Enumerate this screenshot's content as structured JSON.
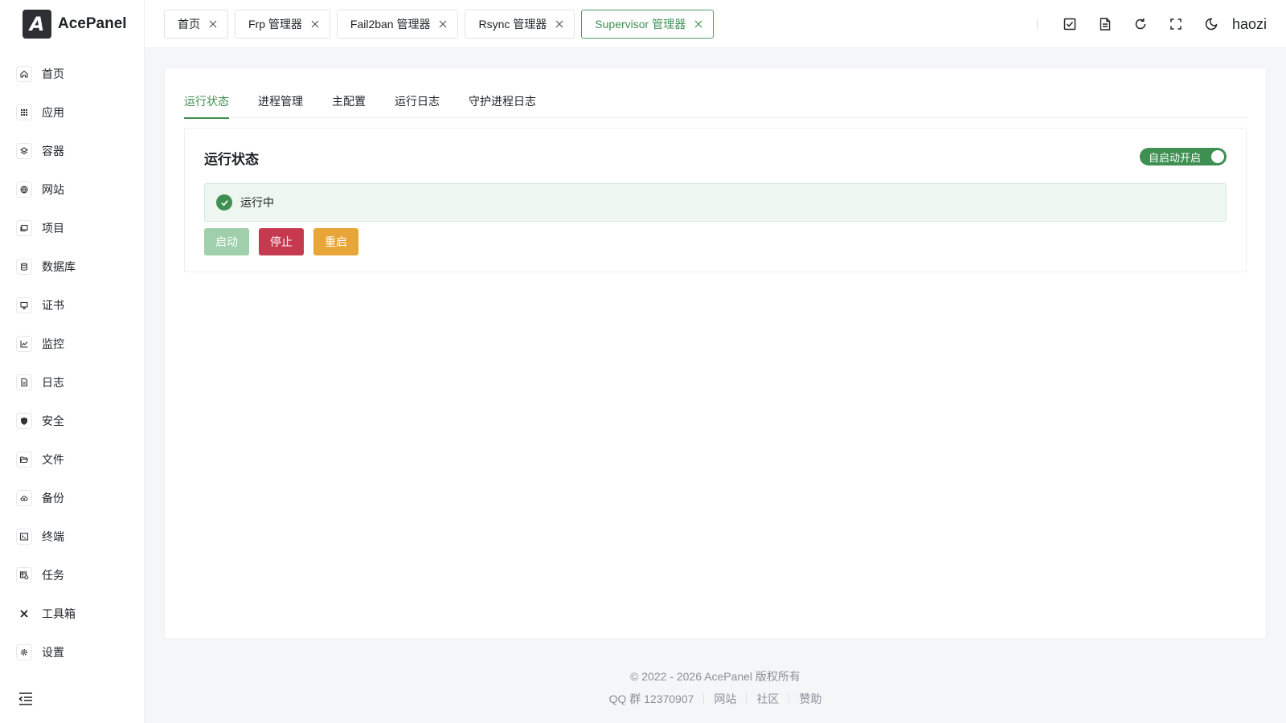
{
  "app": {
    "name": "AcePanel",
    "logo_letter": "A"
  },
  "sidebar": {
    "items": [
      {
        "label": "首页",
        "icon": "home-icon"
      },
      {
        "label": "应用",
        "icon": "apps-grid-icon"
      },
      {
        "label": "容器",
        "icon": "layers-icon"
      },
      {
        "label": "网站",
        "icon": "globe-icon"
      },
      {
        "label": "项目",
        "icon": "folders-icon"
      },
      {
        "label": "数据库",
        "icon": "database-icon"
      },
      {
        "label": "证书",
        "icon": "certificate-icon"
      },
      {
        "label": "监控",
        "icon": "chart-line-icon"
      },
      {
        "label": "日志",
        "icon": "document-icon"
      },
      {
        "label": "安全",
        "icon": "shield-icon"
      },
      {
        "label": "文件",
        "icon": "folder-open-icon"
      },
      {
        "label": "备份",
        "icon": "cloud-upload-icon"
      },
      {
        "label": "终端",
        "icon": "terminal-icon"
      },
      {
        "label": "任务",
        "icon": "tasks-icon"
      },
      {
        "label": "工具箱",
        "icon": "tools-icon"
      },
      {
        "label": "设置",
        "icon": "gear-icon"
      }
    ],
    "collapse_icon": "collapse-menu-icon"
  },
  "topbar": {
    "tabs": [
      {
        "label": "首页",
        "active": false
      },
      {
        "label": "Frp 管理器",
        "active": false
      },
      {
        "label": "Fail2ban 管理器",
        "active": false
      },
      {
        "label": "Rsync 管理器",
        "active": false
      },
      {
        "label": "Supervisor 管理器",
        "active": true
      }
    ],
    "icons": [
      "task-check-icon",
      "file-text-icon",
      "refresh-icon",
      "fullscreen-icon",
      "dark-mode-icon"
    ],
    "username": "haozi"
  },
  "main": {
    "tabs": [
      {
        "label": "运行状态",
        "active": true
      },
      {
        "label": "进程管理",
        "active": false
      },
      {
        "label": "主配置",
        "active": false
      },
      {
        "label": "运行日志",
        "active": false
      },
      {
        "label": "守护进程日志",
        "active": false
      }
    ],
    "status": {
      "title": "运行状态",
      "autostart_label": "自启动开启",
      "autostart_on": true,
      "message": "运行中",
      "buttons": {
        "start": "启动",
        "stop": "停止",
        "restart": "重启"
      }
    }
  },
  "footer": {
    "copyright": "© 2022 - 2026 AcePanel 版权所有",
    "links": [
      "QQ 群 12370907",
      "网站",
      "社区",
      "赞助"
    ]
  },
  "colors": {
    "primary": "#3f8f53",
    "danger": "#c63a50",
    "warning": "#e7a637",
    "disabled_primary": "#9fcfab"
  }
}
